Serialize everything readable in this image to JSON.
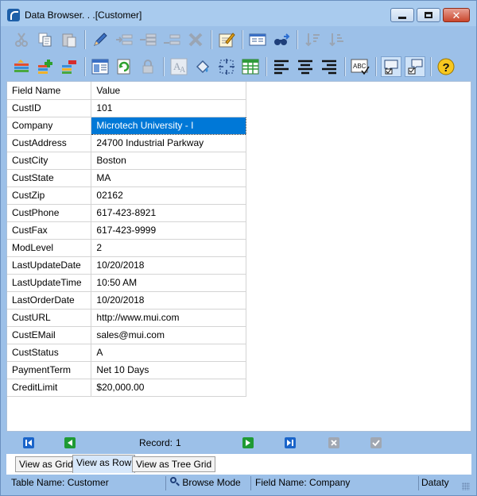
{
  "window": {
    "title": "Data Browser. . .[Customer]"
  },
  "toolbar_top": {
    "buttons": [
      "cut-icon",
      "copy-icon",
      "paste-icon",
      "edit-icon",
      "insert-row-before-icon",
      "insert-row-icon",
      "insert-row-after-icon",
      "delete-icon",
      "edit-form-icon",
      "find-icon",
      "find-next-icon",
      "sort-ascending-icon",
      "sort-descending-icon"
    ]
  },
  "toolbar_bottom": {
    "buttons": [
      "filter-icon",
      "add-filter-icon",
      "remove-filter-icon",
      "layout-icon",
      "refresh-icon",
      "lock-icon",
      "font-icon",
      "fill-color-icon",
      "fit-columns-icon",
      "grid-icon",
      "align-left-icon",
      "align-center-icon",
      "align-right-icon",
      "spell-check-icon",
      "comment-icon",
      "comment-check-icon",
      "help-icon"
    ]
  },
  "grid": {
    "header": {
      "field": "Field Name",
      "value": "Value"
    },
    "rows": [
      {
        "field": "CustID",
        "value": "101"
      },
      {
        "field": "Company",
        "value": "Microtech University - I"
      },
      {
        "field": "CustAddress",
        "value": "24700 Industrial Parkway"
      },
      {
        "field": "CustCity",
        "value": "Boston"
      },
      {
        "field": "CustState",
        "value": "MA"
      },
      {
        "field": "CustZip",
        "value": "02162"
      },
      {
        "field": "CustPhone",
        "value": "617-423-8921"
      },
      {
        "field": "CustFax",
        "value": "617-423-9999"
      },
      {
        "field": "ModLevel",
        "value": "2"
      },
      {
        "field": "LastUpdateDate",
        "value": "10/20/2018"
      },
      {
        "field": "LastUpdateTime",
        "value": "10:50 AM"
      },
      {
        "field": "LastOrderDate",
        "value": "10/20/2018"
      },
      {
        "field": "CustURL",
        "value": "http://www.mui.com"
      },
      {
        "field": "CustEMail",
        "value": "sales@mui.com"
      },
      {
        "field": "CustStatus",
        "value": "A"
      },
      {
        "field": "PaymentTerm",
        "value": "Net 10 Days"
      },
      {
        "field": "CreditLimit",
        "value": "$20,000.00"
      }
    ]
  },
  "navigation": {
    "record_label": "Record:",
    "record_number": "1"
  },
  "tabs": [
    {
      "label": "View as Grid"
    },
    {
      "label": "View as Row"
    },
    {
      "label": "View as Tree Grid"
    }
  ],
  "status": {
    "table_name": "Table Name: Customer",
    "mode": "Browse Mode",
    "field_name": "Field Name: Company",
    "datatype": "Dataty"
  },
  "colors": {
    "accent": "#0078d7",
    "frame": "#9cc0e8"
  }
}
